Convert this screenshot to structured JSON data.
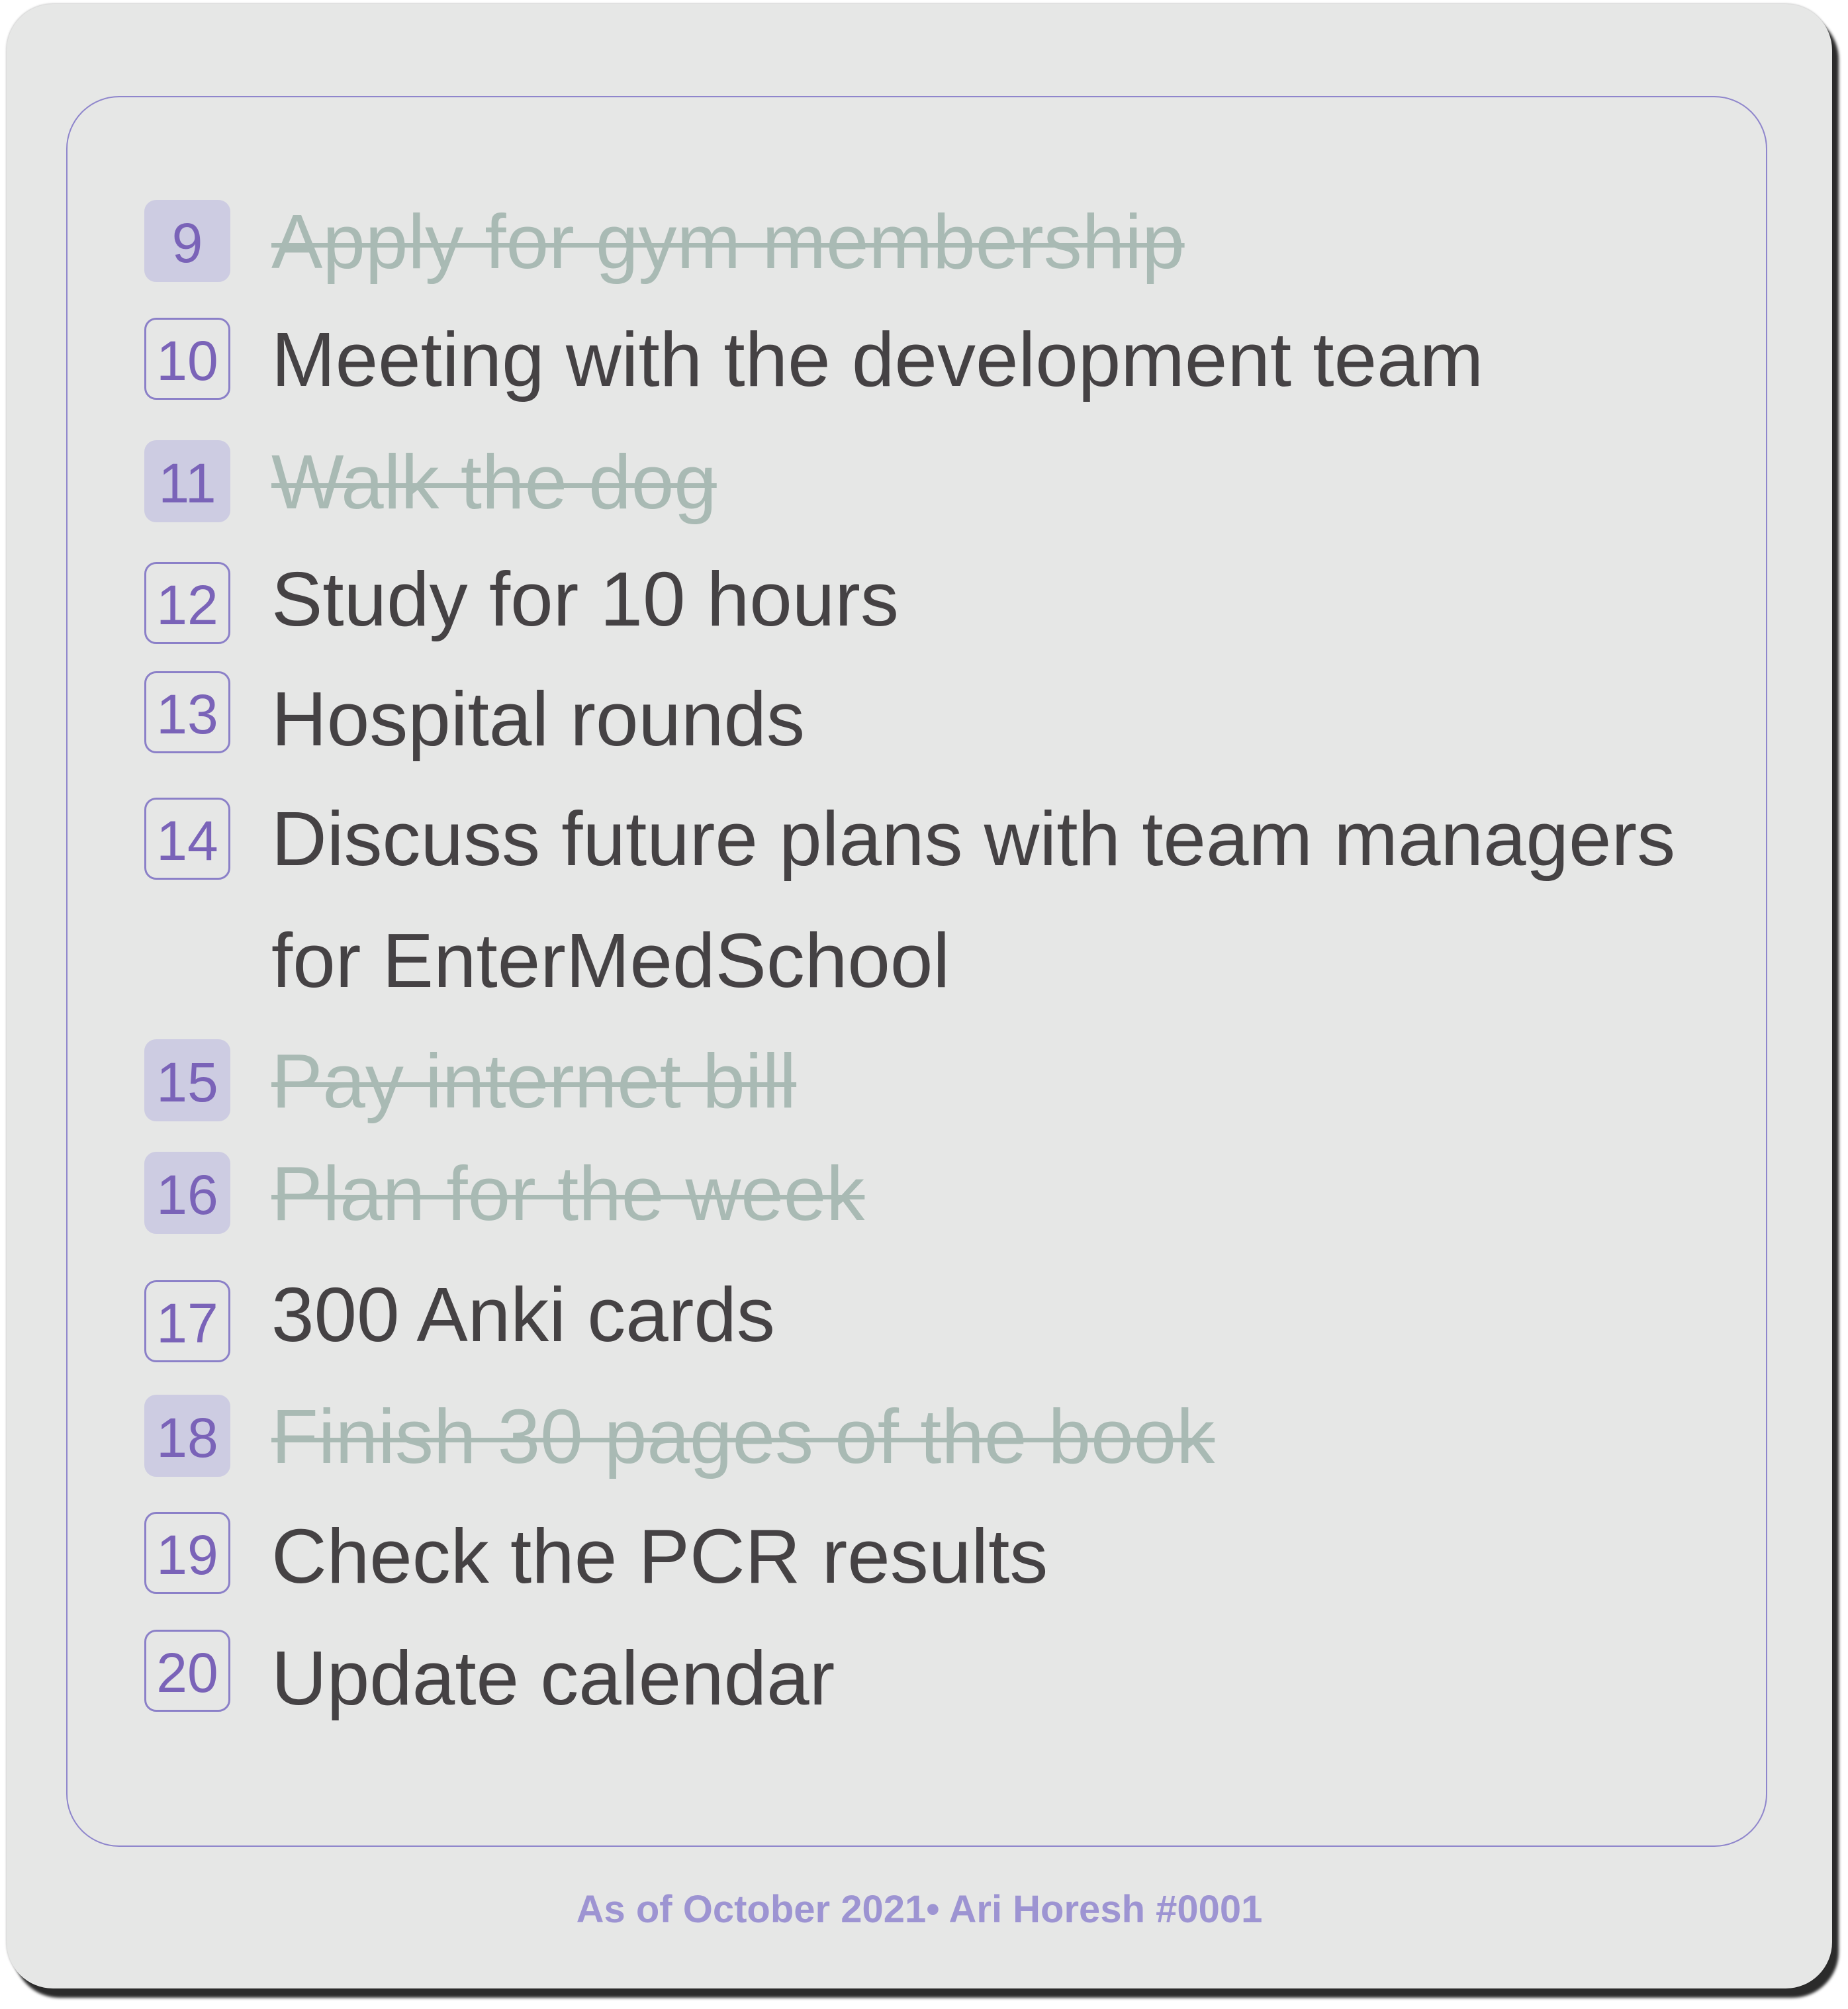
{
  "items": [
    {
      "number": "9",
      "text": "Apply for gym membership",
      "done": true
    },
    {
      "number": "10",
      "text": "Meeting with the development team",
      "done": false
    },
    {
      "number": "11",
      "text": "Walk the dog",
      "done": true
    },
    {
      "number": "12",
      "text": "Study for 10 hours",
      "done": false
    },
    {
      "number": "13",
      "text": "Hospital rounds",
      "done": false
    },
    {
      "number": "14",
      "text": "Discuss future plans with team managers for EnterMedSchool",
      "done": false
    },
    {
      "number": "15",
      "text": "Pay internet bill",
      "done": true
    },
    {
      "number": "16",
      "text": "Plan for the week",
      "done": true
    },
    {
      "number": "17",
      "text": "300 Anki cards",
      "done": false
    },
    {
      "number": "18",
      "text": "Finish 30 pages of the book",
      "done": true
    },
    {
      "number": "19",
      "text": "Check the PCR results",
      "done": false
    },
    {
      "number": "20",
      "text": "Update calendar",
      "done": false
    }
  ],
  "footer": "As of October 2021• Ari Horesh #0001",
  "colors": {
    "card_background": "#e6e7e6",
    "number_text": "#7a63b8",
    "number_outline": "#8b80c8",
    "number_filled_background": "#cdcce2",
    "task_text": "#454244",
    "done_text": "#a9bab4",
    "footer_text": "#9d94d2"
  }
}
